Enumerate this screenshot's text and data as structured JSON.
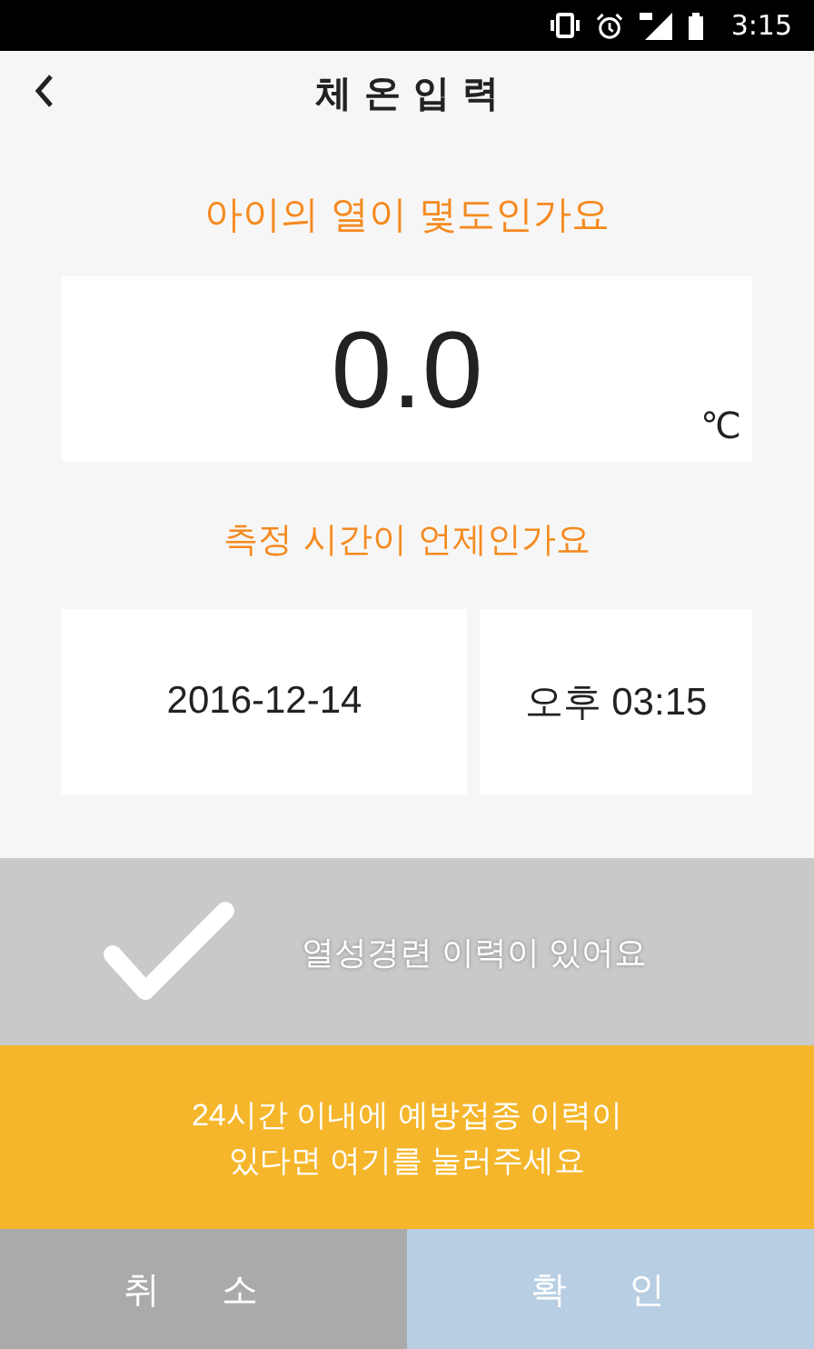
{
  "status_bar": {
    "time": "3:15"
  },
  "header": {
    "title": "체 온 입 력"
  },
  "temperature": {
    "question": "아이의 열이 몇도인가요",
    "value": "0.0",
    "unit": "℃"
  },
  "measure_time": {
    "question": "측정 시간이 언제인가요",
    "date": "2016-12-14",
    "time": "오후 03:15"
  },
  "fever_history": {
    "label": "열성경련 이력이 있어요",
    "checked": false
  },
  "vaccination_notice": {
    "lines": [
      "24시간 이내에 예방접종 이력이",
      "있다면 여기를 눌러주세요"
    ]
  },
  "buttons": [
    {
      "label": "취 소",
      "kind": "cancel"
    },
    {
      "label": "확 인",
      "kind": "confirm"
    }
  ]
}
